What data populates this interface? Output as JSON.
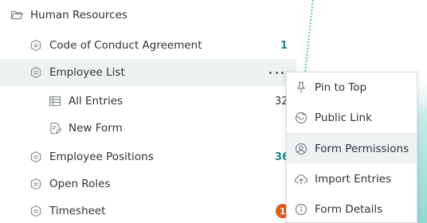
{
  "tree": {
    "group_label": "Human Resources",
    "items": [
      {
        "label": "Code of Conduct Agreement",
        "count": "1"
      },
      {
        "label": "Employee List"
      },
      {
        "label": "All Entries",
        "count": "32"
      },
      {
        "label": "New Form"
      },
      {
        "label": "Employee Positions",
        "count": "36"
      },
      {
        "label": "Open Roles"
      },
      {
        "label": "Timesheet",
        "badge": "1"
      }
    ]
  },
  "context_menu": {
    "items": [
      {
        "label": "Pin to Top",
        "icon": "pin-icon"
      },
      {
        "label": "Public Link",
        "icon": "public-link-icon"
      },
      {
        "label": "Form Permissions",
        "icon": "permissions-icon"
      },
      {
        "label": "Import Entries",
        "icon": "import-icon"
      },
      {
        "label": "Form Details",
        "icon": "info-icon"
      }
    ]
  },
  "colors": {
    "accent_teal": "#1a8a86",
    "badge_orange": "#e05a1c",
    "hover_bg": "#edf1f1"
  }
}
